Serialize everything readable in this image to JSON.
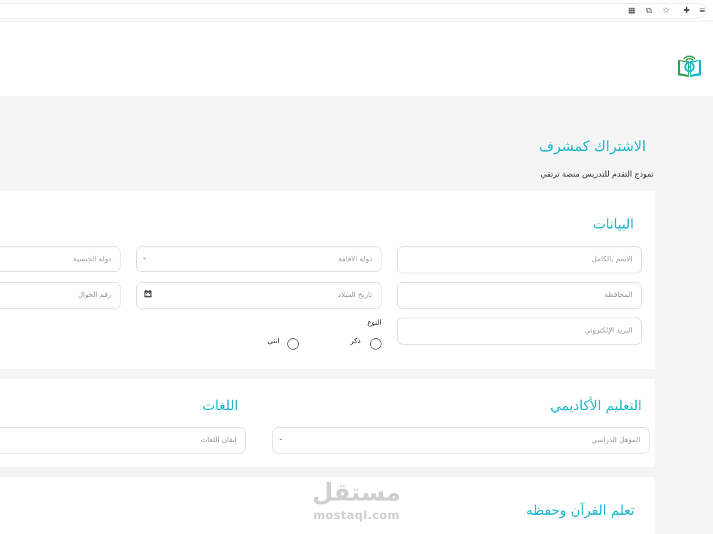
{
  "page": {
    "title": "الاشتراك كمشرف",
    "subtitle": "نموذج التقدم للتدريس منصة ترتقي"
  },
  "browser": {
    "icons": [
      "qr-code-icon",
      "translate-icon",
      "star-icon",
      "extensions-icon",
      "reading-list-icon"
    ]
  },
  "data_section": {
    "title": "البيانات",
    "fields": {
      "full_name": "الاسم بالكامل",
      "residence_country": "دولة الاقامة",
      "nationality": "دولة الجنسية",
      "governorate": "المحافظة",
      "birth_date": "تاريخ الميلاد",
      "mobile": "رقم الجوال",
      "email": "البريد الإلكتروني"
    },
    "gender": {
      "label": "النوع",
      "male": "ذكر",
      "female": "انثى"
    }
  },
  "education_section": {
    "title": "التعليم الأكاديمي",
    "qualification_placeholder": "المؤهل الدراسي"
  },
  "languages_section": {
    "title": "اللغات",
    "languages_placeholder": "إتقان اللغات"
  },
  "quran_section": {
    "title": "تعلم القرآن وحفظه"
  },
  "watermark": {
    "arabic": "مستقل",
    "latin": "mostaql.com"
  },
  "colors": {
    "accent": "#1bb7c9",
    "logo_green": "#3aa55a",
    "background": "#f5f5f5"
  }
}
